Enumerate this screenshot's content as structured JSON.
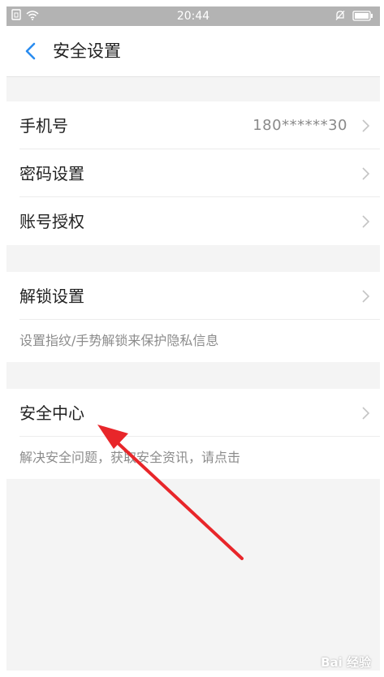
{
  "status_bar": {
    "time": "20:44"
  },
  "header": {
    "title": "安全设置"
  },
  "group_account": {
    "rows": [
      {
        "label": "手机号",
        "value": "180******30"
      },
      {
        "label": "密码设置"
      },
      {
        "label": "账号授权"
      }
    ]
  },
  "group_unlock": {
    "label": "解锁设置",
    "description": "设置指纹/手势解锁来保护隐私信息"
  },
  "group_security_center": {
    "label": "安全中心",
    "description": "解决安全问题，获取安全资讯，请点击"
  },
  "annotation": {
    "arrow_color": "#e8262a"
  },
  "watermark": {
    "text": "Bai 经验"
  }
}
